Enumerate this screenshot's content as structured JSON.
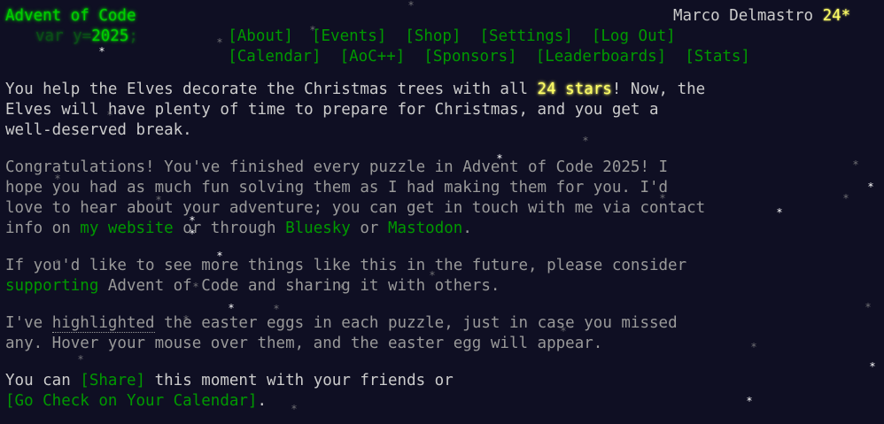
{
  "header": {
    "title": "Advent of Code",
    "year_prefix": "var y=",
    "year": "2025",
    "year_suffix": ";",
    "nav_top": [
      "[About]",
      "[Events]",
      "[Shop]",
      "[Settings]",
      "[Log Out]"
    ],
    "nav_bottom": [
      "[Calendar]",
      "[AoC++]",
      "[Sponsors]",
      "[Leaderboards]",
      "[Stats]"
    ],
    "user_name": "Marco Delmastro",
    "user_stars": "24*"
  },
  "main": {
    "p1": {
      "before": "You help the Elves decorate the Christmas trees with all ",
      "stars": "24 stars",
      "after": "! Now, the\nElves will have plenty of time to prepare for Christmas, and you get a\nwell-deserved break."
    },
    "p2": {
      "text1": "Congratulations! You've finished every puzzle in Advent of Code 2025! I\nhope you had as much fun solving them as I had making them for you. I'd\nlove to hear about your adventure; you can get in touch with me via contact\ninfo on ",
      "link1": "my website",
      "text2": " or through ",
      "link2": "Bluesky",
      "text3": " or ",
      "link3": "Mastodon",
      "text4": "."
    },
    "p3": {
      "text1": "If you'd like to see more things like this in the future, please consider\n",
      "link": "supporting",
      "text2": " Advent of Code and sharing it with others."
    },
    "p4": {
      "text1": "I've ",
      "highlighted": "highlighted",
      "text2": " the easter eggs in each puzzle, just in case you missed\nany. Hover your mouse over them, and the easter egg will appear."
    },
    "p5": {
      "text1": "You can ",
      "share": "[Share]",
      "text2": " this moment with your friends or\n",
      "calendar": "[Go Check on Your Calendar]",
      "text3": "."
    }
  },
  "snowflake_glyph": "*"
}
